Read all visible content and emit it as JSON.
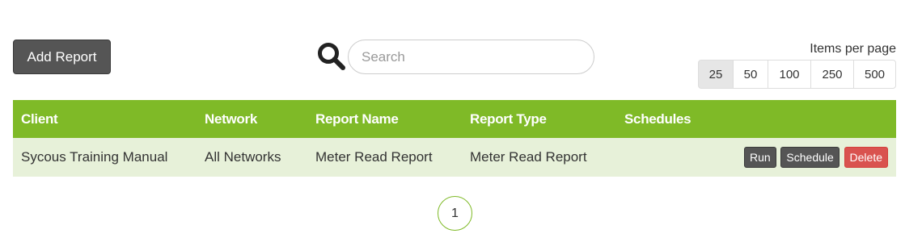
{
  "toolbar": {
    "add_report_label": "Add Report",
    "search_placeholder": "Search",
    "search_value": "",
    "search_icon": "search-icon"
  },
  "items_per_page": {
    "label": "Items per page",
    "options": [
      "25",
      "50",
      "100",
      "250",
      "500"
    ],
    "selected": "25"
  },
  "table": {
    "headers": [
      "Client",
      "Network",
      "Report Name",
      "Report Type",
      "Schedules",
      ""
    ],
    "rows": [
      {
        "client": "Sycous Training Manual",
        "network": "All Networks",
        "report_name": "Meter Read Report",
        "report_type": "Meter Read Report",
        "schedules": "",
        "actions": [
          "Run",
          "Schedule",
          "Delete"
        ]
      }
    ]
  },
  "pagination": {
    "pages": [
      "1"
    ],
    "current": "1"
  },
  "colors": {
    "header_bg": "#7fba27",
    "row_bg": "#e7f1d9",
    "button_dark": "#555555",
    "button_danger": "#d9534f"
  }
}
